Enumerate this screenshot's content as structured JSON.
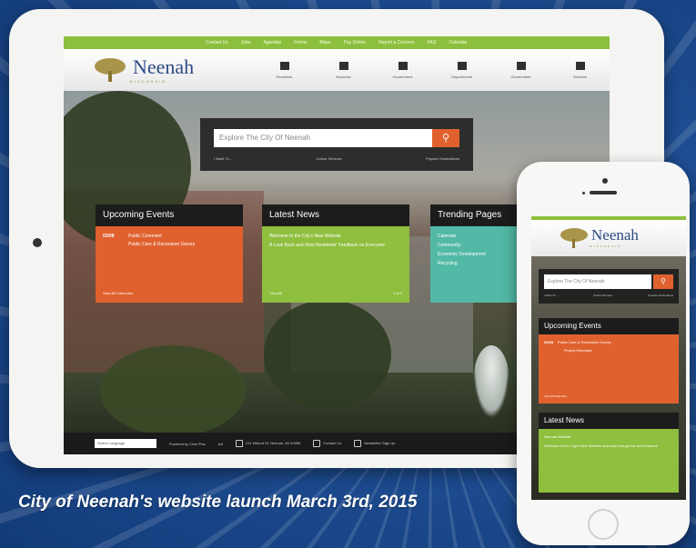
{
  "caption": "City of Neenah's website launch March 3rd, 2015",
  "site": {
    "logo_text": "Neenah",
    "logo_subtext": "WISCONSIN",
    "top_nav": [
      "Contact Us",
      "Jobs",
      "Agendas",
      "Forms",
      "Maps",
      "Pay Online",
      "Report a Concern",
      "FAQ",
      "Calendar"
    ],
    "main_nav": [
      {
        "icon": "home-icon",
        "label": "Residents"
      },
      {
        "icon": "business-icon",
        "label": "Business"
      },
      {
        "icon": "government-icon",
        "label": "Government"
      },
      {
        "icon": "departments-icon",
        "label": "Departments"
      },
      {
        "icon": "visitors-icon",
        "label": "Government"
      },
      {
        "icon": "services-icon",
        "label": "Services"
      }
    ],
    "search_placeholder": "Explore The City Of Neenah",
    "quick_links": [
      "I Want To...",
      "Online Services",
      "Popular Destinations"
    ],
    "events": {
      "title": "Upcoming Events",
      "items": [
        {
          "date": "03/08",
          "title": "Public Comment"
        },
        {
          "date": "",
          "title": "Public Care & Recreation Survey"
        }
      ],
      "link": "View All Calendars"
    },
    "news": {
      "title": "Latest News",
      "items": [
        "Welcome to the City's New Website",
        "A Look Back and View Residents' Feedback on Everyone"
      ],
      "link": "View All",
      "pager": "1 of 3"
    },
    "trending": {
      "title": "Trending Pages",
      "items": [
        "Calendar",
        "Community",
        "Economic Development",
        "Recycling"
      ]
    },
    "footer": {
      "language": "Select Language",
      "items": [
        "Powered by Civic Plus",
        "AA",
        "211 Walnut St, Neenah, WI 54956",
        "Contact Us",
        "Newsletter Sign Up"
      ]
    }
  },
  "phone": {
    "logo_text": "Neenah",
    "logo_subtext": "WISCONSIN",
    "search_placeholder": "Explore The City Of Neenah",
    "quick_links": [
      "I Want To...",
      "Online Services",
      "Popular Destinations"
    ],
    "events_title": "Upcoming Events",
    "event_date": "03/08",
    "event_title": "Public Care & Recreation Survey",
    "event_sub": "Project Extended",
    "events_link": "View All Calendars",
    "news_title": "Latest News",
    "news_item": "Neenah Website",
    "news_body": "Welcome to the City's New Website and look through the new features"
  },
  "colors": {
    "green": "#8dbf3e",
    "orange": "#e0612e",
    "teal": "#52b9a6",
    "navy": "#2e4a86"
  }
}
